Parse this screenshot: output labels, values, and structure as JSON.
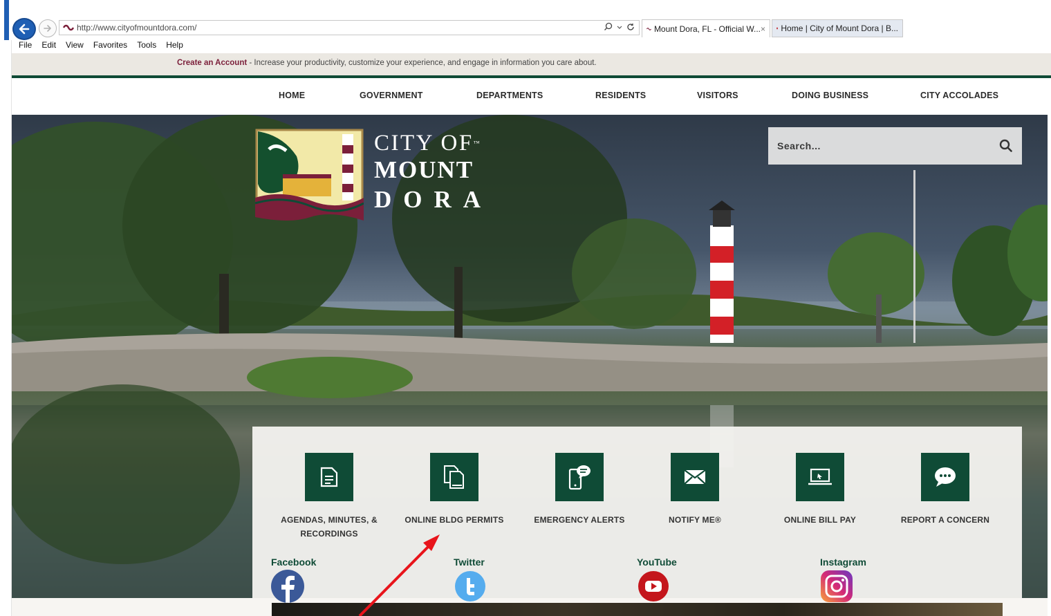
{
  "browser": {
    "url": "http://www.cityofmountdora.com/",
    "tabs": [
      {
        "label": "Mount Dora, FL - Official W...",
        "close": "×"
      },
      {
        "label": "Home | City of Mount Dora | B..."
      }
    ],
    "menu": [
      "File",
      "Edit",
      "View",
      "Favorites",
      "Tools",
      "Help"
    ]
  },
  "announce": {
    "link": "Create an Account",
    "text": " - Increase your productivity, customize your experience, and engage in information you care about."
  },
  "nav": [
    "HOME",
    "GOVERNMENT",
    "DEPARTMENTS",
    "RESIDENTS",
    "VISITORS",
    "DOING BUSINESS",
    "CITY ACCOLADES"
  ],
  "logo": {
    "line1": "CITY OF",
    "line2": "MOUNT",
    "line3": "DORA",
    "tm": "™"
  },
  "search": {
    "placeholder": "Search..."
  },
  "quick_links": [
    {
      "label": "AGENDAS, MINUTES, & RECORDINGS",
      "icon": "document-icon"
    },
    {
      "label": "ONLINE BLDG PERMITS",
      "icon": "copy-documents-icon"
    },
    {
      "label": "EMERGENCY ALERTS",
      "icon": "mobile-chat-icon"
    },
    {
      "label": "NOTIFY ME®",
      "icon": "envelope-icon"
    },
    {
      "label": "ONLINE BILL PAY",
      "icon": "laptop-icon"
    },
    {
      "label": "REPORT A CONCERN",
      "icon": "speech-bubble-icon"
    }
  ],
  "social": [
    {
      "label": "Facebook",
      "icon": "facebook-icon",
      "color": "#3b5998"
    },
    {
      "label": "Twitter",
      "icon": "twitter-icon",
      "color": "#55acee"
    },
    {
      "label": "YouTube",
      "icon": "youtube-icon",
      "color": "#d0021b"
    },
    {
      "label": "Instagram",
      "icon": "instagram-icon",
      "color": "#c13584"
    }
  ],
  "colors": {
    "brand_green": "#0f4b36",
    "accent_maroon": "#7b1f3a",
    "annotation_red": "#e8141b"
  }
}
